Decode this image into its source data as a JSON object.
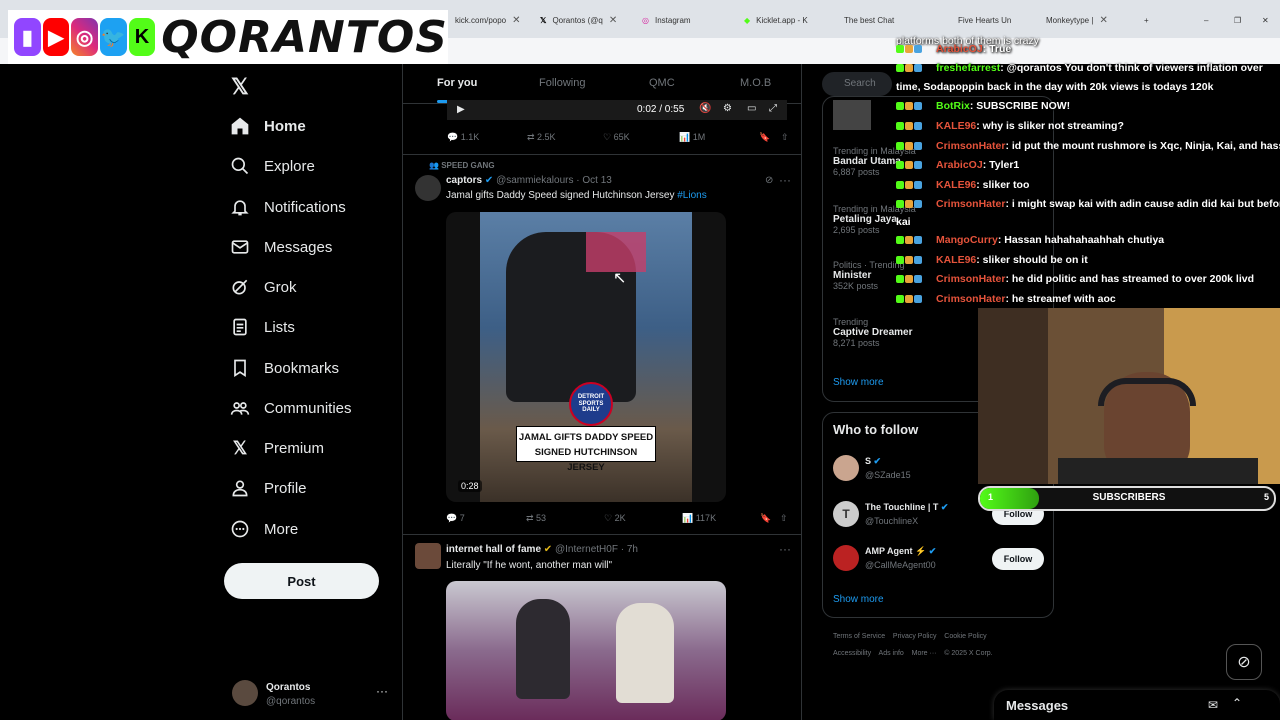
{
  "browser": {
    "tabs": [
      {
        "label": "kick.com/popo"
      },
      {
        "label": "Qorantos (@q"
      },
      {
        "label": "Instagram"
      },
      {
        "label": "Kicklet.app - K"
      },
      {
        "label": "The best Chat"
      },
      {
        "label": "Five Hearts Un"
      },
      {
        "label": "Monkeytype | "
      }
    ]
  },
  "overlay": {
    "brand": "QORANTOS"
  },
  "nav": {
    "items": [
      {
        "label": "Home",
        "icon": "home-icon"
      },
      {
        "label": "Explore",
        "icon": "search-icon"
      },
      {
        "label": "Notifications",
        "icon": "bell-icon"
      },
      {
        "label": "Messages",
        "icon": "mail-icon"
      },
      {
        "label": "Grok",
        "icon": "grok-icon"
      },
      {
        "label": "Lists",
        "icon": "list-icon"
      },
      {
        "label": "Bookmarks",
        "icon": "bookmark-icon"
      },
      {
        "label": "Communities",
        "icon": "people-icon"
      },
      {
        "label": "Premium",
        "icon": "x-icon"
      },
      {
        "label": "Profile",
        "icon": "person-icon"
      },
      {
        "label": "More",
        "icon": "more-circle-icon"
      }
    ],
    "post_label": "Post",
    "profile": {
      "name": "Qorantos",
      "handle": "@qorantos",
      "menu": "···"
    }
  },
  "feed": {
    "tabs": [
      "For you",
      "Following",
      "QMC",
      "M.O.B"
    ],
    "top_video_time": "0:02 / 0:55",
    "top_stats": {
      "replies": "1.1K",
      "reposts": "2.5K",
      "likes": "65K",
      "views": "1M"
    },
    "tweet1": {
      "social_context": "SPEED GANG",
      "name": "captors",
      "handle": "@sammiekalours",
      "date": "· Oct 13",
      "text": "Jamal gifts Daddy Speed signed Hutchinson Jersey",
      "hashtag": "#Lions",
      "video_caption_l1": "JAMAL GIFTS DADDY SPEED",
      "video_caption_l2": "SIGNED HUTCHINSON JERSEY",
      "video_logo": "DETROIT SPORTS DAILY",
      "duration": "0:28",
      "stats": {
        "replies": "7",
        "reposts": "53",
        "likes": "2K",
        "views": "117K"
      }
    },
    "tweet2": {
      "name": "internet hall of fame",
      "handle": "@InternetH0F",
      "date": "· 7h",
      "text": "Literally \"If he wont, another man will\""
    }
  },
  "right": {
    "search_placeholder": "Search",
    "trends": [
      {
        "sub": "Trending in Malaysia",
        "name": "Bandar Utama",
        "count": "6,887 posts"
      },
      {
        "sub": "Trending in Malaysia",
        "name": "Petaling Jaya",
        "count": "2,695 posts"
      },
      {
        "sub": "Politics · Trending",
        "name": "Minister",
        "count": "352K posts"
      },
      {
        "sub": "Trending",
        "name": "Captive Dreamer",
        "count": "8,271 posts"
      }
    ],
    "show_more": "Show more",
    "who_to_follow_title": "Who to follow",
    "who": [
      {
        "name": "S",
        "handle": "@SZade15"
      },
      {
        "name": "The Touchline | T",
        "handle": "@TouchlineX",
        "btn": "Follow"
      },
      {
        "name": "AMP Agent ⚡",
        "handle": "@CallMeAgent00",
        "btn": "Follow"
      }
    ],
    "show_more2": "Show more",
    "footer": {
      "l1": [
        "Terms of Service",
        "Privacy Policy",
        "Cookie Policy"
      ],
      "l2": [
        "Accessibility",
        "Ads info",
        "More ···",
        "© 2025 X Corp."
      ]
    },
    "messages_label": "Messages"
  },
  "chat": {
    "top_line": "platforms both of them is crazy",
    "lines": [
      {
        "user": "ArabicOJ",
        "color": "#e5533b",
        "msg": ": True"
      },
      {
        "user": "freshefarrest",
        "color": "#53fc18",
        "msg": ": @qorantos You don't think of viewers inflation over"
      },
      {
        "user": "",
        "color": "#fff",
        "msg": "time, Sodapoppin back in the day with 20k views is todays 120k"
      },
      {
        "user": "BotRix",
        "color": "#53fc18",
        "msg": ": SUBSCRIBE NOW!"
      },
      {
        "user": "KALE96",
        "color": "#e5533b",
        "msg": ": why is sliker not streaming?"
      },
      {
        "user": "CrimsonHater",
        "color": "#e5533b",
        "msg": ": id put the mount rushmore is Xqc, Ninja, Kai, and hassan"
      },
      {
        "user": "ArabicOJ",
        "color": "#e5533b",
        "msg": ": Tyler1"
      },
      {
        "user": "KALE96",
        "color": "#e5533b",
        "msg": ": sliker too"
      },
      {
        "user": "CrimsonHater",
        "color": "#e5533b",
        "msg": ": i might swap kai with adin cause adin did kai but before"
      },
      {
        "user": "",
        "color": "#fff",
        "msg": "kai"
      },
      {
        "user": "MangoCurry",
        "color": "#e5533b",
        "msg": ": Hassan hahahahaahhah chutiya"
      },
      {
        "user": "KALE96",
        "color": "#e5533b",
        "msg": ": sliker should be on it"
      },
      {
        "user": "CrimsonHater",
        "color": "#e5533b",
        "msg": ": he did politic and has streamed to over 200k livd"
      },
      {
        "user": "CrimsonHater",
        "color": "#e5533b",
        "msg": ": he streamef with aoc"
      }
    ]
  },
  "subs": {
    "left": "1",
    "label": "SUBSCRIBERS",
    "right": "5",
    "progress": 0.2
  }
}
